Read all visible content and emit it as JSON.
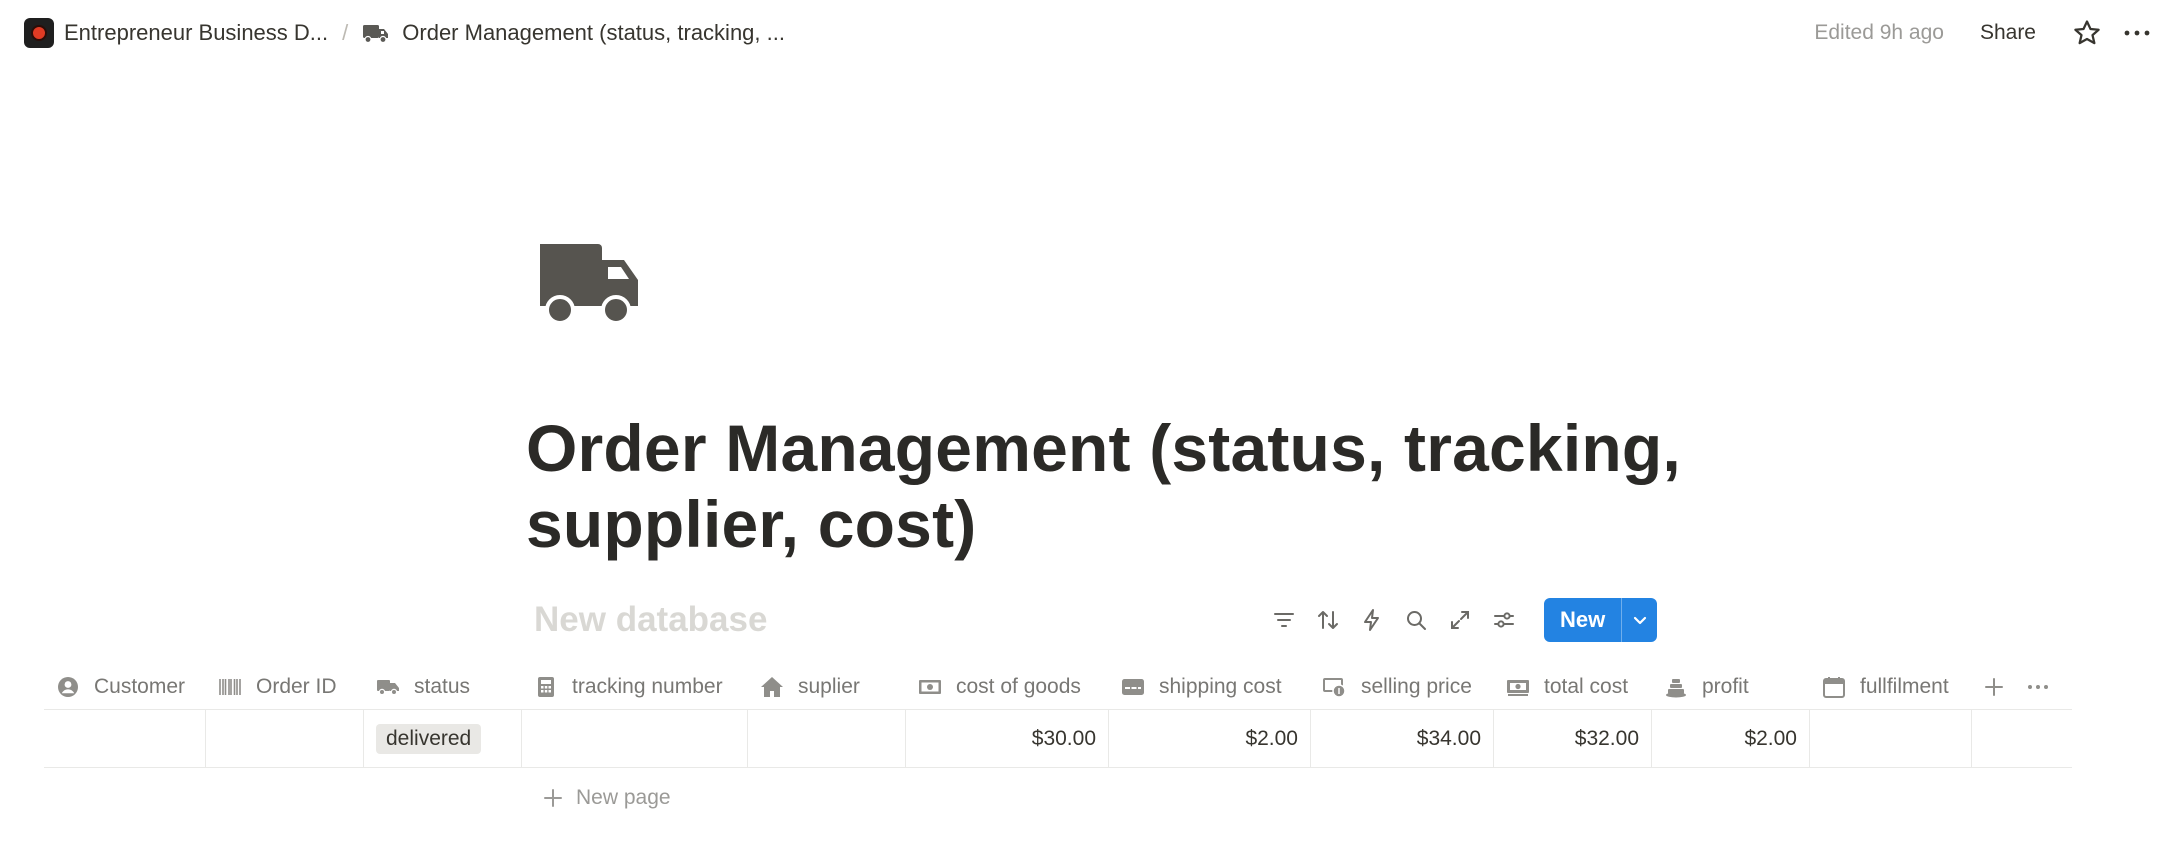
{
  "breadcrumb": {
    "workspace": "Entrepreneur Business D...",
    "separator": "/",
    "page": "Order Management (status, tracking, ..."
  },
  "topbar": {
    "edited": "Edited 9h ago",
    "share": "Share",
    "icons": [
      "star-icon",
      "more-icon"
    ]
  },
  "page": {
    "icon": "truck-icon",
    "title": "Order Management (status, tracking, supplier, cost)"
  },
  "database": {
    "name": "New database",
    "tools": [
      "filter-icon",
      "sort-icon",
      "automation-icon",
      "search-icon",
      "expand-icon",
      "settings-icon"
    ],
    "new_label": "New",
    "accent": "#2383e2"
  },
  "table": {
    "columns": [
      {
        "label": "Customer",
        "icon": "person-icon"
      },
      {
        "label": "Order ID",
        "icon": "barcode-icon"
      },
      {
        "label": "status",
        "icon": "truck-icon"
      },
      {
        "label": "tracking number",
        "icon": "calculator-icon"
      },
      {
        "label": "suplier",
        "icon": "home-icon"
      },
      {
        "label": "cost of goods",
        "icon": "money-icon"
      },
      {
        "label": "shipping cost",
        "icon": "card-icon"
      },
      {
        "label": "selling price",
        "icon": "cash-coin-icon"
      },
      {
        "label": "total cost",
        "icon": "money-stack-icon"
      },
      {
        "label": "profit",
        "icon": "coins-icon"
      },
      {
        "label": "fullfilment",
        "icon": "calendar-icon"
      }
    ],
    "rows": [
      {
        "customer": "",
        "order_id": "",
        "status": "delivered",
        "tracking_number": "",
        "suplier": "",
        "cost_of_goods": "$30.00",
        "shipping_cost": "$2.00",
        "selling_price": "$34.00",
        "total_cost": "$32.00",
        "profit": "$2.00",
        "fullfilment": ""
      }
    ],
    "new_page": "New page"
  }
}
